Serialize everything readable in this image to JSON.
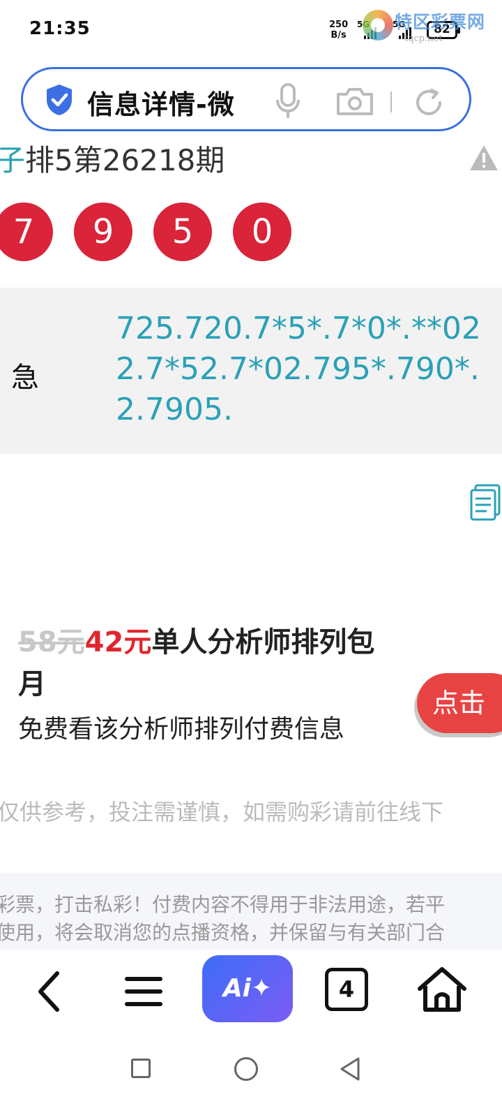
{
  "status_bar": {
    "time": "21:35",
    "net_speed_value": "250",
    "net_speed_unit": "B/s",
    "signal1_label": "5G",
    "signal2_label": "5G",
    "battery": "82"
  },
  "watermark": {
    "site_name": "特区彩票网",
    "url": "tqcp.net"
  },
  "search_bar": {
    "title": "信息详情-微",
    "icons": [
      "shield-check-icon",
      "mic-icon",
      "camera-icon",
      "refresh-icon"
    ]
  },
  "lottery": {
    "period_prefix": "子",
    "period_text": "排5第26218期",
    "numbers": [
      "7",
      "9",
      "5",
      "0"
    ]
  },
  "panel": {
    "label": "急",
    "lines": [
      "725.720.7*5*.7*0*.**02",
      "2.7*52.7*02.795*.790*.",
      "2.7905."
    ]
  },
  "promo": {
    "old_price": "58元",
    "new_price": "42元",
    "title": "单人分析师排列包月",
    "description": "免费看该分析师排列付费信息",
    "button_label": "点击"
  },
  "disclaimer": "仅供参考，投注需谨慎，如需购彩请前往线下",
  "notice": {
    "line1": "彩票，打击私彩！付费内容不得用于非法用途，若平",
    "line2": "使用，将会取消您的点播资格，并保留与有关部门合"
  },
  "toolbar": {
    "ai_label": "Ai✦",
    "tab_count": "4"
  },
  "colors": {
    "ball_red": "#d9243a",
    "accent_blue": "#3a6fe0",
    "teal_numbers": "#2aa0b8",
    "price_red": "#e0262d"
  }
}
